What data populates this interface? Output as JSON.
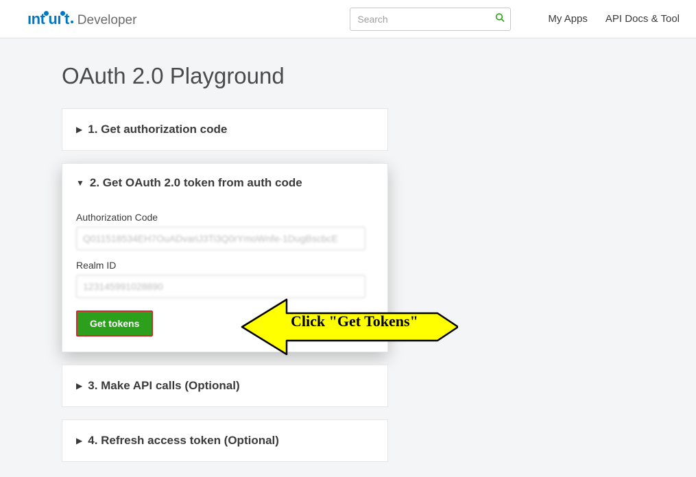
{
  "header": {
    "logo_brand": "intuit",
    "logo_sub": "Developer",
    "search_placeholder": "Search",
    "nav": {
      "my_apps": "My Apps",
      "api_docs": "API Docs & Tool"
    }
  },
  "page": {
    "title": "OAuth 2.0 Playground"
  },
  "steps": {
    "step1": {
      "title": "1. Get authorization code"
    },
    "step2": {
      "title": "2. Get OAuth 2.0 token from auth code",
      "auth_code_label": "Authorization Code",
      "auth_code_value": "Q011518534EH7OuADvariJ3Ti3Q0rYmoWnfe-1DugBscbcE",
      "realm_id_label": "Realm ID",
      "realm_id_value": "123145991028890",
      "button_label": "Get tokens"
    },
    "step3": {
      "title": "3. Make API calls (Optional)"
    },
    "step4": {
      "title": "4. Refresh access token (Optional)"
    }
  },
  "annotation": {
    "text": "Click \"Get Tokens\""
  }
}
